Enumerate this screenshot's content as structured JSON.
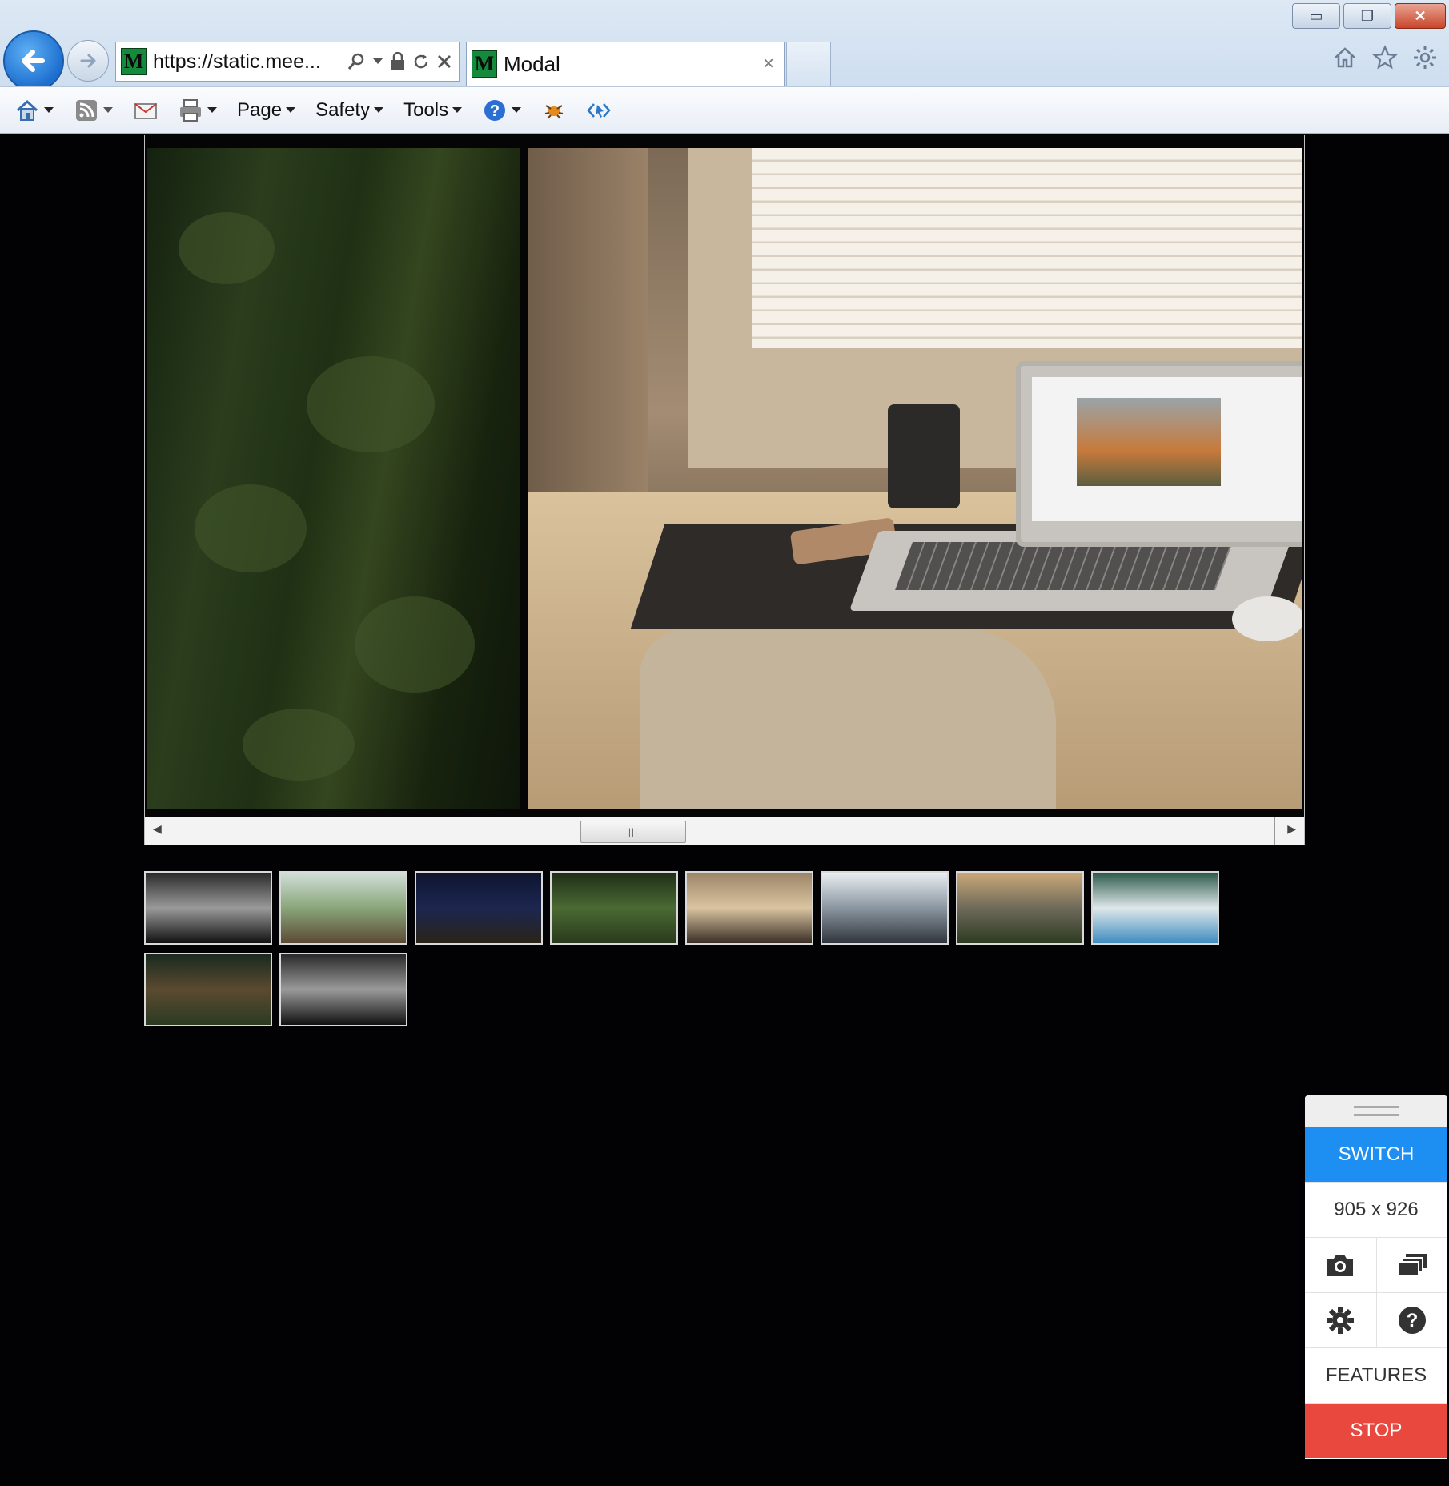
{
  "window_controls": {
    "minimize_glyph": "▭",
    "restore_glyph": "❐",
    "close_glyph": "✕"
  },
  "address_bar": {
    "favicon_letter": "M",
    "url_prefix": "https://",
    "url_rest": "static.mee..."
  },
  "tab": {
    "favicon_letter": "M",
    "label": "Modal",
    "close_glyph": "×"
  },
  "command_bar": {
    "page_label": "Page",
    "safety_label": "Safety",
    "tools_label": "Tools"
  },
  "viewer": {
    "scroll_thumb_glyph": "|||",
    "scroll_left_glyph": "◀",
    "scroll_right_glyph": "▶"
  },
  "thumbnails": [
    {
      "name": "thumb-spiral-stairs",
      "colors": [
        "#2a2a2a",
        "#9a9a9a",
        "#111111"
      ]
    },
    {
      "name": "thumb-lake-pier",
      "colors": [
        "#cfe0d8",
        "#8aa57a",
        "#5b4a35"
      ]
    },
    {
      "name": "thumb-night-sky",
      "colors": [
        "#0f1530",
        "#1c2650",
        "#2a2418"
      ]
    },
    {
      "name": "thumb-forest-aerial",
      "colors": [
        "#1e2e17",
        "#4a6a33",
        "#2a3a1d"
      ]
    },
    {
      "name": "thumb-desk-laptop",
      "colors": [
        "#9d8568",
        "#d9c4a0",
        "#3a2e25"
      ]
    },
    {
      "name": "thumb-cloudy-peaks",
      "colors": [
        "#e9eef2",
        "#8b96a0",
        "#30353c"
      ]
    },
    {
      "name": "thumb-mountain-valley",
      "colors": [
        "#c9a878",
        "#6f6a5a",
        "#2d3a22"
      ]
    },
    {
      "name": "thumb-bridge-underside",
      "colors": [
        "#2d5a4a",
        "#dfe8ea",
        "#3f8cc0"
      ]
    },
    {
      "name": "thumb-woods-person",
      "colors": [
        "#1a2a20",
        "#5b4a30",
        "#2b3b22"
      ]
    },
    {
      "name": "thumb-spiral-stairs-2",
      "colors": [
        "#2a2a2a",
        "#9a9a9a",
        "#111111"
      ]
    }
  ],
  "panel": {
    "switch_label": "SWITCH",
    "resolution": "905 x 926",
    "features_label": "FEATURES",
    "stop_label": "STOP",
    "icons": [
      "camera-icon",
      "layers-icon",
      "gear-icon",
      "help-icon"
    ]
  },
  "colors": {
    "page_background": "#020104",
    "switch_blue": "#1e8ff2",
    "stop_red": "#e8483d"
  }
}
